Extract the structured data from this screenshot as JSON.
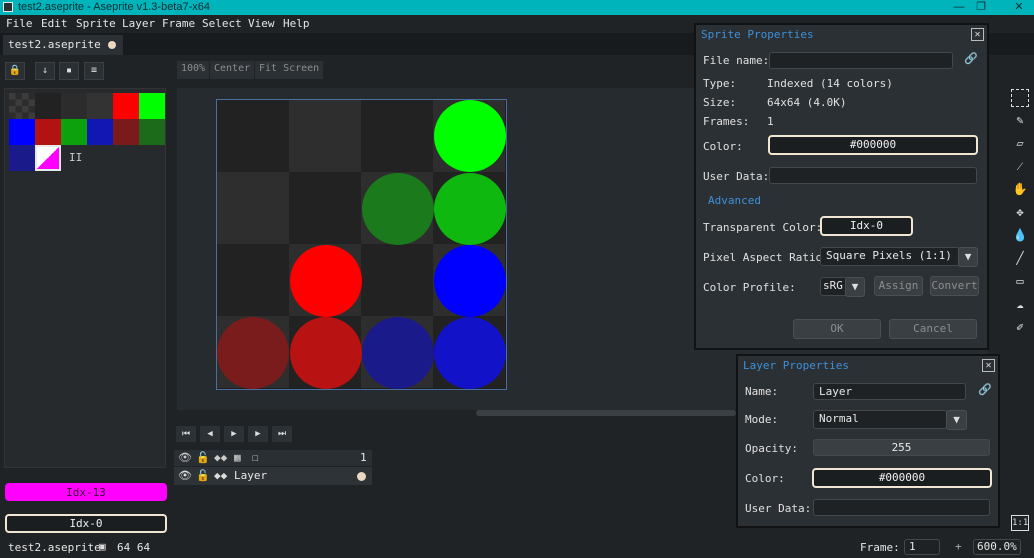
{
  "window": {
    "title": "test2.aseprite - Aseprite v1.3-beta7-x64",
    "minimize": "—",
    "maximize": "❐",
    "close": "✕"
  },
  "menu": [
    "File",
    "Edit",
    "Sprite",
    "Layer",
    "Frame",
    "Select",
    "View",
    "Help"
  ],
  "tab": {
    "label": "test2.aseprite"
  },
  "zoom_buttons": {
    "percent": "100%",
    "center": "Center",
    "fit": "Fit Screen"
  },
  "palette_colors": [
    "#111111",
    "#222222",
    "#333333",
    "#444444",
    "#555555",
    "#ff0000",
    "#00ff00",
    "#0000ff",
    "#b31212",
    "#0b8a0b",
    "#1217b3",
    "#7a1a1a",
    "#1b6b1b",
    "#1a1a8a",
    "#ff00ff"
  ],
  "palette_extra_label": "II",
  "fg_color": {
    "label": "Idx-13",
    "color": "#ff00ff"
  },
  "bg_color": {
    "label": "Idx-0"
  },
  "timeline": {
    "frame_number": "1",
    "layer_name": "Layer"
  },
  "sprite_props": {
    "title": "Sprite Properties",
    "file_name_label": "File name:",
    "file_name": "",
    "type_label": "Type:",
    "type": "Indexed (14 colors)",
    "size_label": "Size:",
    "size": "64x64 (4.0K)",
    "frames_label": "Frames:",
    "frames": "1",
    "color_label": "Color:",
    "color": "#000000",
    "user_data_label": "User Data:",
    "user_data": "",
    "advanced": "Advanced",
    "transparent_label": "Transparent Color:",
    "transparent": "Idx-0",
    "aspect_label": "Pixel Aspect Ratio:",
    "aspect": "Square Pixels (1:1)",
    "profile_label": "Color Profile:",
    "profile": "sRG",
    "assign": "Assign",
    "convert": "Convert",
    "ok": "OK",
    "cancel": "Cancel"
  },
  "layer_props": {
    "title": "Layer Properties",
    "name_label": "Name:",
    "name": "Layer",
    "mode_label": "Mode:",
    "mode": "Normal",
    "opacity_label": "Opacity:",
    "opacity": "255",
    "color_label": "Color:",
    "color": "#000000",
    "user_data_label": "User Data:",
    "user_data": ""
  },
  "status": {
    "file": "test2.aseprite",
    "dims": "64 64",
    "frame_label": "Frame:",
    "frame": "1",
    "zoom": "600.0%",
    "plus": "+"
  },
  "right_tools": [
    "marquee-icon",
    "pencil-icon",
    "eraser-icon",
    "eyedropper-icon",
    "hand-icon",
    "move-icon",
    "fill-icon",
    "line-icon",
    "rect-icon",
    "blur-icon",
    "contour-icon"
  ],
  "ratio_badge": "1:1"
}
